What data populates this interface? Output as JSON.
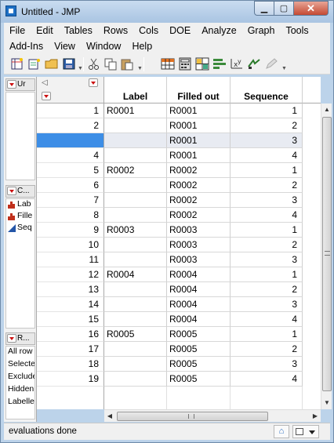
{
  "window": {
    "title": "Untitled - JMP",
    "close_glyph": "✕",
    "maximize_glyph": "▢",
    "minimize_glyph": "▁"
  },
  "menu": {
    "row1": [
      "File",
      "Edit",
      "Tables",
      "Rows",
      "Cols",
      "DOE",
      "Analyze",
      "Graph",
      "Tools"
    ],
    "row2": [
      "Add-Ins",
      "View",
      "Window",
      "Help"
    ]
  },
  "toolbar_icons": [
    "new-data-table-icon",
    "open-file-icon",
    "open-folder-icon",
    "save-icon",
    "cut-icon",
    "copy-icon",
    "paste-icon",
    "data-grid-icon",
    "calculator-icon",
    "tables-icon",
    "distribution-icon",
    "fit-y-by-x-icon",
    "fit-model-icon",
    "edit-icon"
  ],
  "panels": {
    "table_panel_label": "Ur",
    "columns_panel_label": "C...",
    "columns": [
      {
        "name": "Lab",
        "icon": "nominal-column-icon"
      },
      {
        "name": "Fille",
        "icon": "nominal-column-icon"
      },
      {
        "name": "Seq",
        "icon": "continuous-column-icon"
      }
    ],
    "rows_panel_label": "R...",
    "row_states": [
      "All row",
      "Selecte",
      "Exclude",
      "Hidden",
      "Labelle"
    ]
  },
  "grid": {
    "columns": [
      "Label",
      "Filled out",
      "Sequence"
    ],
    "selected_row": 3,
    "rows": [
      {
        "n": "1",
        "label": "R0001",
        "filled": "R0001",
        "seq": "1"
      },
      {
        "n": "2",
        "label": "",
        "filled": "R0001",
        "seq": "2"
      },
      {
        "n": "3",
        "label": "",
        "filled": "R0001",
        "seq": "3"
      },
      {
        "n": "4",
        "label": "",
        "filled": "R0001",
        "seq": "4"
      },
      {
        "n": "5",
        "label": "R0002",
        "filled": "R0002",
        "seq": "1"
      },
      {
        "n": "6",
        "label": "",
        "filled": "R0002",
        "seq": "2"
      },
      {
        "n": "7",
        "label": "",
        "filled": "R0002",
        "seq": "3"
      },
      {
        "n": "8",
        "label": "",
        "filled": "R0002",
        "seq": "4"
      },
      {
        "n": "9",
        "label": "R0003",
        "filled": "R0003",
        "seq": "1"
      },
      {
        "n": "10",
        "label": "",
        "filled": "R0003",
        "seq": "2"
      },
      {
        "n": "11",
        "label": "",
        "filled": "R0003",
        "seq": "3"
      },
      {
        "n": "12",
        "label": "R0004",
        "filled": "R0004",
        "seq": "1"
      },
      {
        "n": "13",
        "label": "",
        "filled": "R0004",
        "seq": "2"
      },
      {
        "n": "14",
        "label": "",
        "filled": "R0004",
        "seq": "3"
      },
      {
        "n": "15",
        "label": "",
        "filled": "R0004",
        "seq": "4"
      },
      {
        "n": "16",
        "label": "R0005",
        "filled": "R0005",
        "seq": "1"
      },
      {
        "n": "17",
        "label": "",
        "filled": "R0005",
        "seq": "2"
      },
      {
        "n": "18",
        "label": "",
        "filled": "R0005",
        "seq": "3"
      },
      {
        "n": "19",
        "label": "",
        "filled": "R0005",
        "seq": "4"
      }
    ]
  },
  "status": {
    "text": "evaluations done",
    "home_glyph": "⌂"
  },
  "colors": {
    "selection": "#3d8ee6",
    "triangle_red": "#cc1111"
  }
}
